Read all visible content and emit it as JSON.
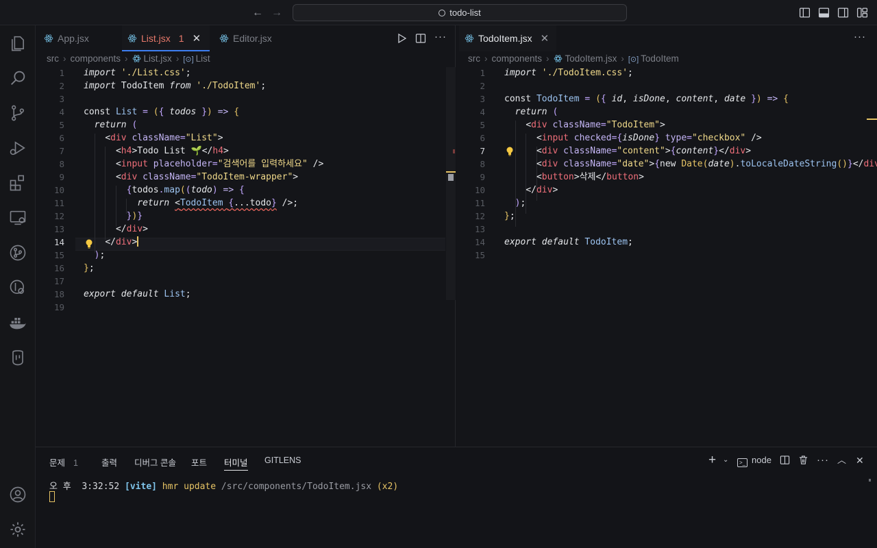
{
  "titlebar": {
    "search_text": "todo-list"
  },
  "left_editor": {
    "tabs": [
      {
        "label": "App.jsx"
      },
      {
        "label": "List.jsx",
        "problems": "1"
      },
      {
        "label": "Editor.jsx"
      }
    ],
    "breadcrumb": [
      "src",
      "components",
      "List.jsx",
      "List"
    ],
    "line_numbers": [
      "1",
      "2",
      "3",
      "4",
      "5",
      "6",
      "7",
      "8",
      "9",
      "10",
      "11",
      "12",
      "13",
      "14",
      "15",
      "16",
      "17",
      "18",
      "19"
    ],
    "current_line": "14"
  },
  "right_editor": {
    "tabs": [
      {
        "label": "TodoItem.jsx"
      }
    ],
    "breadcrumb": [
      "src",
      "components",
      "TodoItem.jsx",
      "TodoItem"
    ],
    "line_numbers": [
      "1",
      "2",
      "3",
      "4",
      "5",
      "6",
      "7",
      "8",
      "9",
      "10",
      "11",
      "12",
      "13",
      "14",
      "15"
    ],
    "current_line": "7"
  },
  "panel": {
    "tabs": [
      {
        "label": "문제",
        "badge": "1"
      },
      {
        "label": "출력"
      },
      {
        "label": "디버그 콘솔"
      },
      {
        "label": "포트"
      },
      {
        "label": "터미널"
      },
      {
        "label": "GITLENS"
      }
    ],
    "terminal_name": "node",
    "terminal_line": {
      "prefix": "오 후  3:32:52 ",
      "tag": "[vite]",
      "msg": " hmr update ",
      "path": "/src/components/TodoItem.jsx",
      "suffix": " (x2)"
    }
  },
  "colors": {
    "accent": "#3d7ef0",
    "error": "#e8796b",
    "warning": "#e7c465"
  }
}
